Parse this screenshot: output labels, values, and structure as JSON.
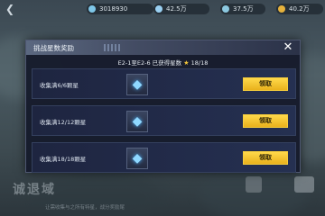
{
  "topbar": {
    "resources": [
      {
        "value": "3018930",
        "icon": "crystal-icon"
      },
      {
        "value": "42.5万",
        "icon": "fuel-icon"
      },
      {
        "value": "37.5万",
        "icon": "ammo-icon"
      },
      {
        "value": "40.2万",
        "icon": "gold-icon"
      }
    ],
    "plus": "+"
  },
  "background": {
    "side_label": "",
    "bottom_title": "诚退域",
    "bottom_hint": "让需收集与之所有特星，战分奖励尾"
  },
  "dialog": {
    "title": "挑战星数奖励",
    "close": "✕",
    "progress_prefix": "E2-1至E2-6 已获得星数",
    "progress_value": "18/18",
    "rows": [
      {
        "label": "收集满6/6颗星",
        "button": "领取",
        "reward_icon": "diamond-icon"
      },
      {
        "label": "收集满12/12颗星",
        "button": "领取",
        "reward_icon": "diamond-icon"
      },
      {
        "label": "收集满18/18颗星",
        "button": "领取",
        "reward_icon": "diamond-icon"
      }
    ]
  },
  "colors": {
    "accent_button": "#f3c531",
    "dialog_bg": "#161b2c",
    "star": "#f1c43a"
  }
}
